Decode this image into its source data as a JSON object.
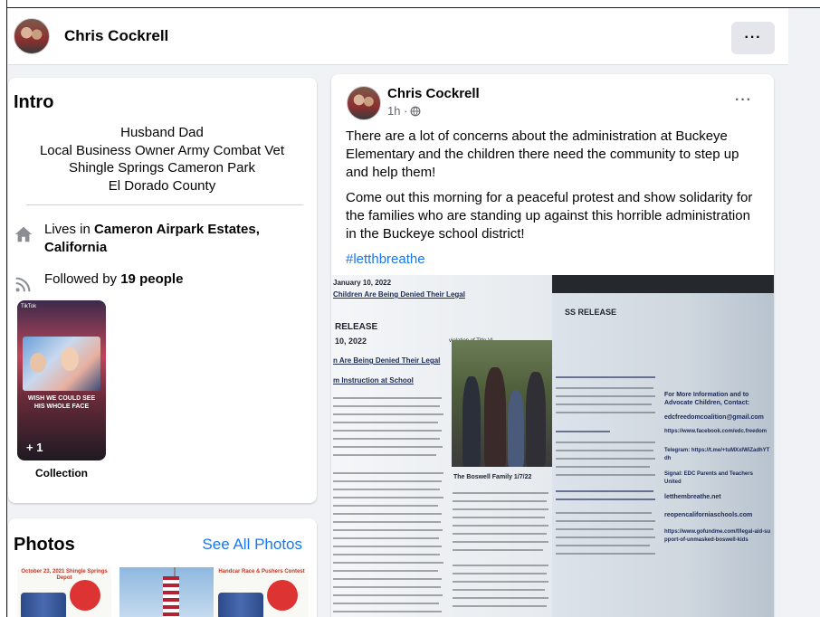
{
  "header": {
    "name": "Chris Cockrell",
    "more_label": "···"
  },
  "intro": {
    "title": "Intro",
    "bio_lines": [
      "Husband Dad",
      "Local Business Owner Army Combat Vet",
      "Shingle Springs Cameron Park",
      "El Dorado County"
    ],
    "lives_prefix": "Lives in ",
    "lives_place": "Cameron Airpark Estates, California",
    "followed_prefix": "Followed by ",
    "followed_count": "19 people",
    "collection_caption": "WISH WE COULD SEE HIS WHOLE FACE",
    "collection_tag": "TikTok",
    "collection_more": "+ 1",
    "collection_label": "Collection"
  },
  "photos": {
    "title": "Photos",
    "see_all": "See All Photos",
    "thumb1_title": "October 23, 2021 Shingle Springs Depot",
    "thumb3_title": "Handcar Race & Pushers Contest"
  },
  "post": {
    "author": "Chris Cockrell",
    "time": "1h ·",
    "more_label": "···",
    "paragraph1": "There are a lot of concerns about the administration at Buckeye Elementary and the children there need the community to step up and help them!",
    "paragraph2": "Come out this morning for a peaceful protest and show solidarity for the families who are standing up against this horrible administration in the Buckeye school district!",
    "hashtag": "#letthbreathe",
    "image": {
      "left_date": "January 10, 2022",
      "left_headline": "Children Are Being Denied Their Legal",
      "release": "RELEASE",
      "release_date": "10, 2022",
      "sub_headline": "n Are Being Denied Their Legal",
      "sub_headline2": "m Instruction at School",
      "family_caption": "The Boswell Family 1/7/22",
      "right_release": "SS RELEASE",
      "violation": "violation of Title VI.",
      "more_info": "For More Information and to Advocate Children, Contact:",
      "email": "edcfreedomcoalition@gmail.com",
      "facebook": "https://www.facebook.com/edc.freedom",
      "telegram": "Telegram: https://t.me/+tuMXxIWiZadhYTdh",
      "signal": "Signal: EDC Parents and Teachers United",
      "site1": "letthembreathe.net",
      "site2": "reopencaliforniaschools.com",
      "gofundme": "https://www.gofundme.com/f/legal-aid-support-of-unmasked-boswell-kids"
    }
  }
}
